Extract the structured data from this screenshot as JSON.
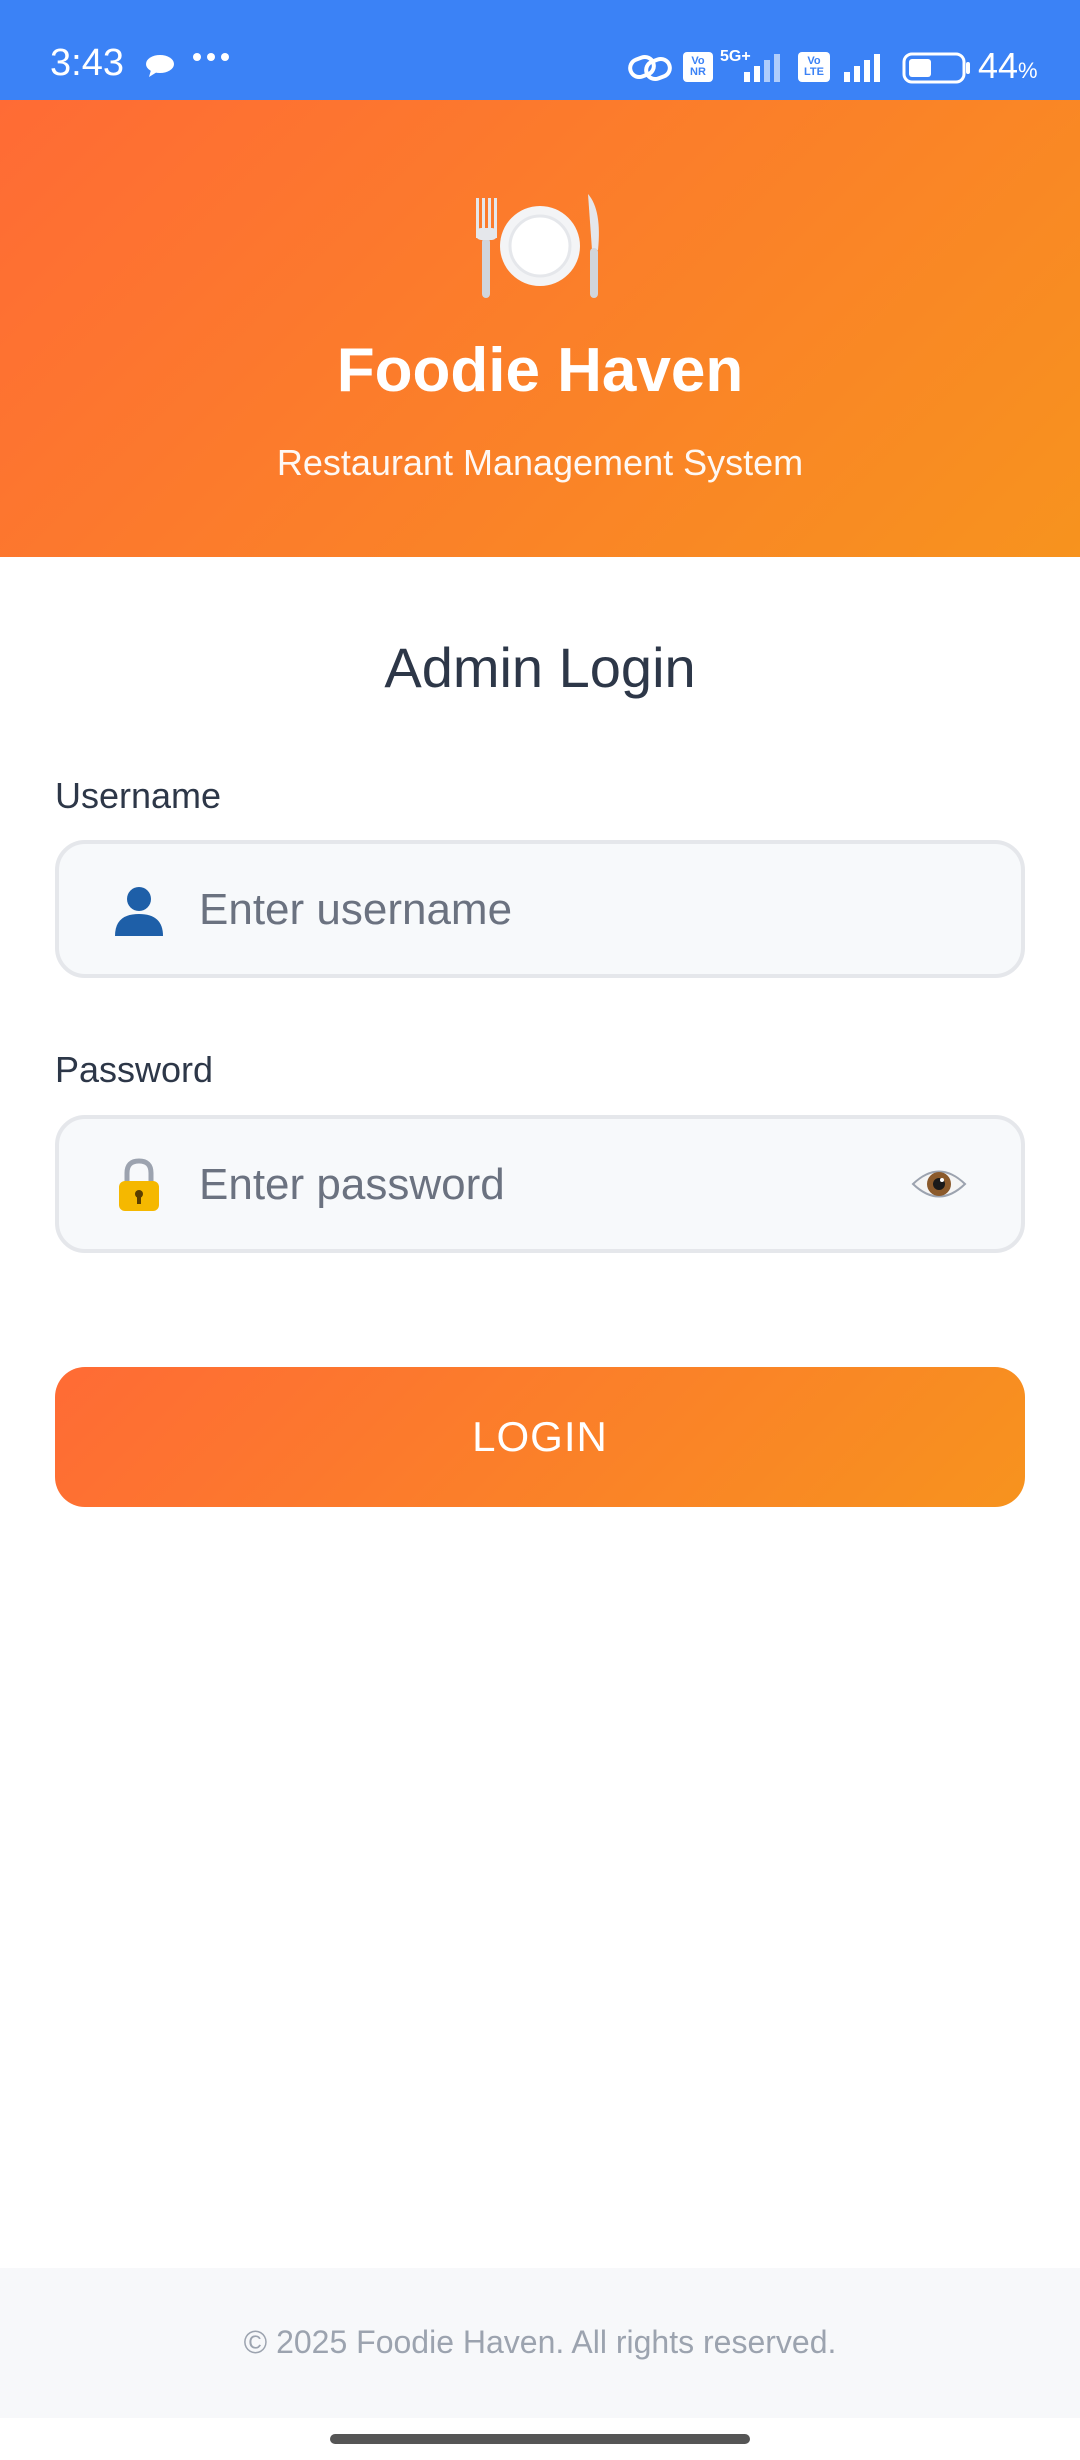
{
  "status_bar": {
    "time": "3:43",
    "network": "5G+",
    "vonr_badge": "Vo NR",
    "volte_badge": "Vo LTE",
    "battery_percent": "44",
    "battery_unit": "%",
    "battery_level": 0.44,
    "icons": [
      "chat-bubble-icon",
      "more-dots-icon",
      "link-icon",
      "signal-icon",
      "battery-icon"
    ]
  },
  "header": {
    "logo_icon": "plate-cutlery-icon",
    "title": "Foodie Haven",
    "subtitle": "Restaurant Management System"
  },
  "login": {
    "title": "Admin Login",
    "username": {
      "label": "Username",
      "placeholder": "Enter username",
      "value": "",
      "icon": "user-icon"
    },
    "password": {
      "label": "Password",
      "placeholder": "Enter password",
      "value": "",
      "icon": "lock-icon",
      "toggle_icon": "eye-icon"
    },
    "button_label": "LOGIN"
  },
  "footer": {
    "text": "© 2025 Foodie Haven. All rights reserved."
  },
  "colors": {
    "status_bar": "#3b82f6",
    "brand_start": "#ff6b35",
    "brand_end": "#f7931e",
    "heading_text": "#2d3748",
    "input_bg": "#f7f9fb",
    "input_border": "#e5e7eb",
    "footer_bg": "#f7f8fa",
    "footer_text": "#9ca3af"
  }
}
